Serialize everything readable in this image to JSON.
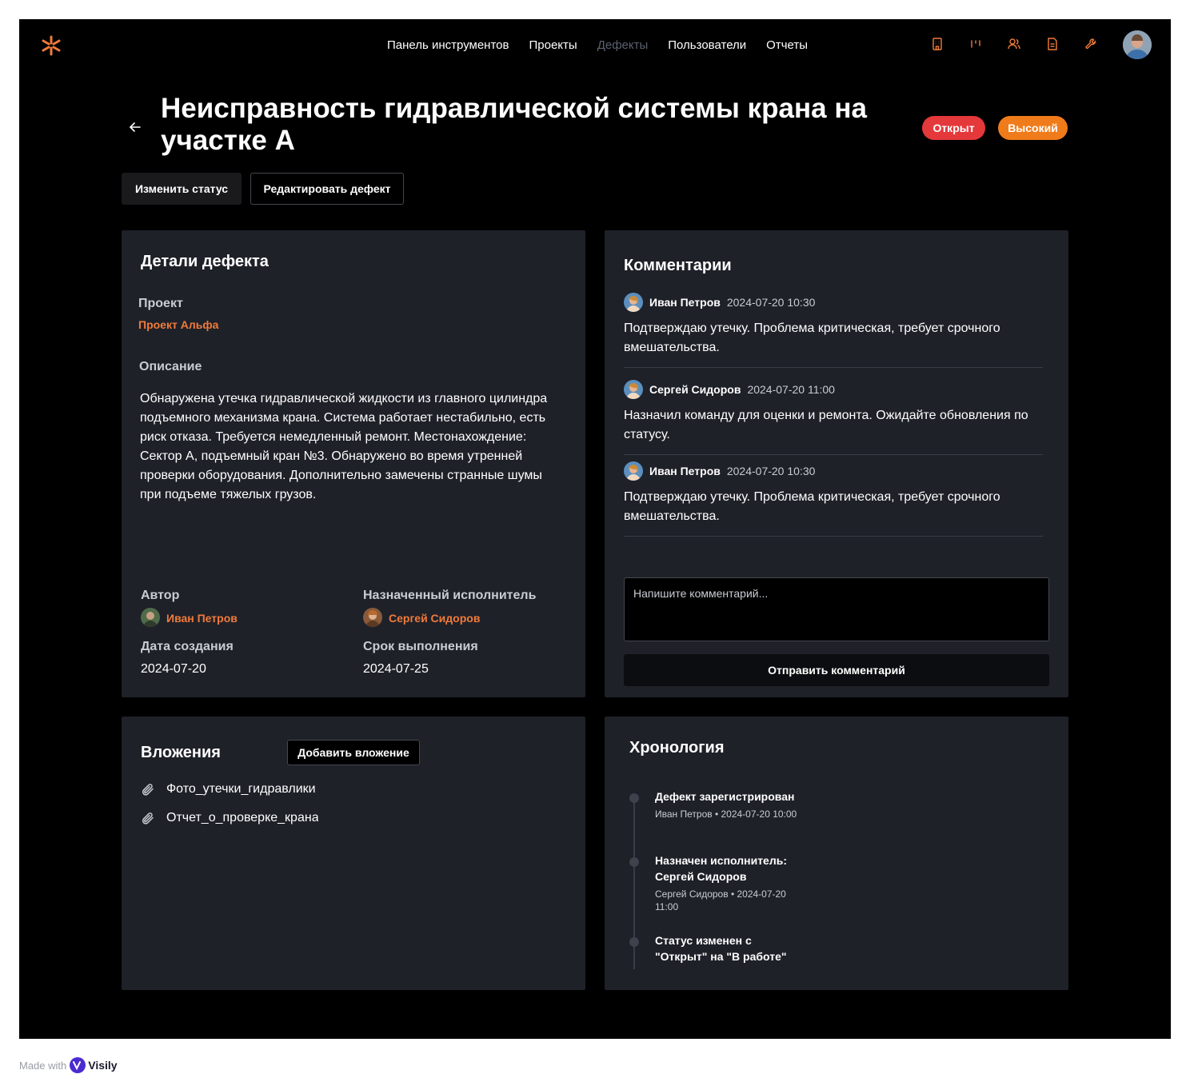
{
  "nav": {
    "items": [
      {
        "label": "Панель инструментов",
        "active": false
      },
      {
        "label": "Проекты",
        "active": false
      },
      {
        "label": "Дефекты",
        "active": true
      },
      {
        "label": "Пользователи",
        "active": false
      },
      {
        "label": "Отчеты",
        "active": false
      }
    ],
    "icons": [
      "building-icon",
      "kanban-icon",
      "users-icon",
      "document-icon",
      "wrench-icon"
    ],
    "accent": "#f07b3a"
  },
  "defect": {
    "title": "Неисправность гидравлической системы крана на участке А",
    "status": "Открыт",
    "priority": "Высокий",
    "status_color": "#e5383b",
    "priority_color": "#f07b1a"
  },
  "actions": {
    "change_status": "Изменить статус",
    "edit_defect": "Редактировать дефект"
  },
  "details": {
    "heading": "Детали дефекта",
    "project_label": "Проект",
    "project_value": "Проект Альфа",
    "description_label": "Описание",
    "description": "Обнаружена утечка гидравлической жидкости из главного цилиндра подъемного механизма крана. Система работает нестабильно, есть риск отказа. Требуется немедленный ремонт. Местонахождение: Сектор А, подъемный кран №3. Обнаружено во время утренней проверки оборудования. Дополнительно замечены странные шумы при подъеме тяжелых грузов.",
    "author_label": "Автор",
    "author": "Иван Петров",
    "assignee_label": "Назначенный исполнитель",
    "assignee": "Сергей Сидоров",
    "created_label": "Дата создания",
    "created": "2024-07-20",
    "due_label": "Срок выполнения",
    "due": "2024-07-25"
  },
  "comments": {
    "heading": "Комментарии",
    "items": [
      {
        "author": "Иван Петров",
        "time": "2024-07-20 10:30",
        "text": "Подтверждаю утечку. Проблема критическая, требует срочного вмешательства."
      },
      {
        "author": "Сергей Сидоров",
        "time": "2024-07-20 11:00",
        "text": "Назначил команду для оценки и ремонта. Ожидайте обновления по статусу."
      },
      {
        "author": "Иван Петров",
        "time": "2024-07-20 10:30",
        "text": "Подтверждаю утечку. Проблема критическая, требует срочного вмешательства."
      }
    ],
    "placeholder": "Напишите комментарий...",
    "send": "Отправить комментарий"
  },
  "attachments": {
    "heading": "Вложения",
    "add": "Добавить вложение",
    "files": [
      "Фото_утечки_гидравлики",
      "Отчет_о_проверке_крана"
    ]
  },
  "timeline": {
    "heading": "Хронология",
    "events": [
      {
        "title": "Дефект зарегистрирован",
        "meta": "Иван Петров • 2024-07-20 10:00"
      },
      {
        "title": "Назначен исполнитель: Сергей Сидоров",
        "meta": "Сергей Сидоров • 2024-07-20 11:00"
      },
      {
        "title": "Статус изменен с \"Открыт\" на \"В работе\"",
        "meta": ""
      }
    ]
  },
  "footer": {
    "made_with": "Made with",
    "brand": "Visily"
  }
}
